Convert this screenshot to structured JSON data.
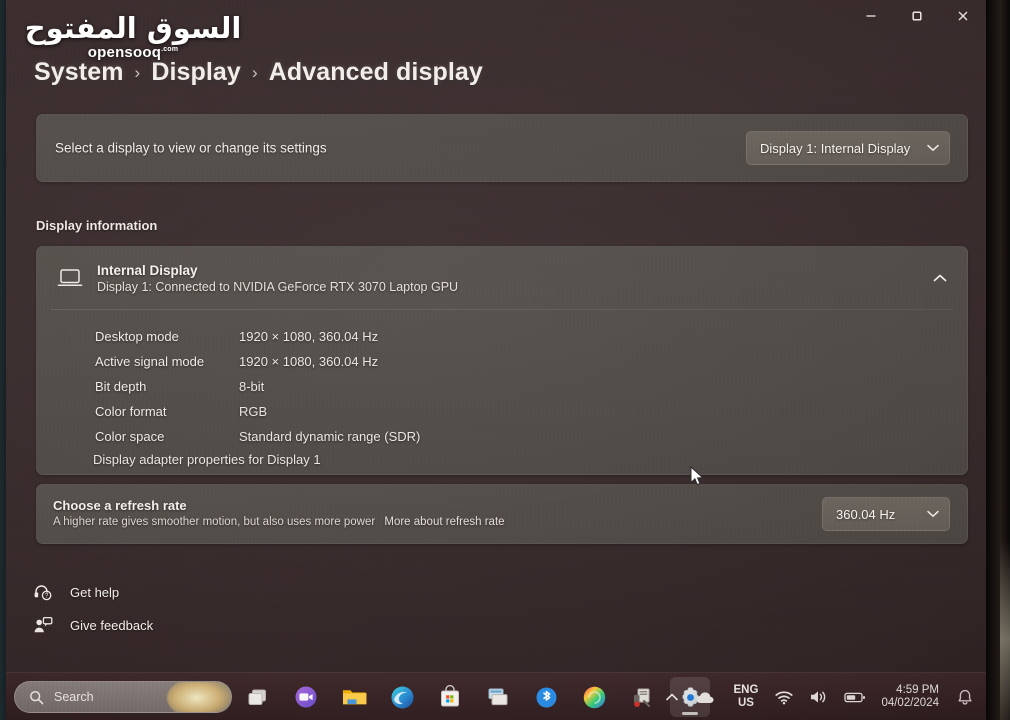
{
  "window": {
    "controls": {
      "minimize": "Minimize",
      "maximize": "Restore",
      "close": "Close"
    }
  },
  "watermark": {
    "arabic": "السوق المفتوح",
    "latin": "opensooq",
    "suffix": ".com"
  },
  "breadcrumb": {
    "items": [
      "System",
      "Display",
      "Advanced display"
    ],
    "separator": "›"
  },
  "select_display": {
    "label": "Select a display to view or change its settings",
    "combo_value": "Display 1: Internal Display",
    "chevron": "⌄"
  },
  "display_information": {
    "heading": "Display information",
    "device_title": "Internal Display",
    "device_subtitle": "Display 1: Connected to NVIDIA GeForce RTX 3070 Laptop GPU",
    "rows": [
      {
        "key": "Desktop mode",
        "value": "1920 × 1080, 360.04 Hz"
      },
      {
        "key": "Active signal mode",
        "value": "1920 × 1080, 360.04 Hz"
      },
      {
        "key": "Bit depth",
        "value": "8-bit"
      },
      {
        "key": "Color format",
        "value": "RGB"
      },
      {
        "key": "Color space",
        "value": "Standard dynamic range (SDR)"
      }
    ],
    "adapter_link": "Display adapter properties for Display 1"
  },
  "refresh_rate": {
    "title": "Choose a refresh rate",
    "description": "A higher rate gives smoother motion, but also uses more power",
    "more_link": "More about refresh rate",
    "combo_value": "360.04 Hz"
  },
  "footer": {
    "get_help": "Get help",
    "give_feedback": "Give feedback"
  },
  "taskbar": {
    "search_placeholder": "Search",
    "apps": [
      {
        "name": "task-view",
        "label": "Task view"
      },
      {
        "name": "chat",
        "label": "Chat"
      },
      {
        "name": "file-explorer",
        "label": "File Explorer"
      },
      {
        "name": "edge",
        "label": "Microsoft Edge"
      },
      {
        "name": "microsoft-store",
        "label": "Microsoft Store"
      },
      {
        "name": "app-window",
        "label": "App"
      },
      {
        "name": "bluetooth",
        "label": "Bluetooth"
      },
      {
        "name": "paint-swirl-app",
        "label": "Creative app"
      },
      {
        "name": "tools-app",
        "label": "Tools app"
      },
      {
        "name": "settings",
        "label": "Settings"
      }
    ],
    "tray": {
      "overflow": "Show hidden icons",
      "cloud": "OneDrive",
      "language_line1": "ENG",
      "language_line2": "US",
      "network": "Network",
      "volume": "Volume",
      "battery": "Battery",
      "time": "4:59 PM",
      "date": "04/02/2024",
      "notifications": "Notifications"
    }
  },
  "colors": {
    "window_bg": "#3a2c2d",
    "card_bg": "#514b47",
    "combo_bg": "#665f59",
    "text_primary": "#f4efeb",
    "taskbar_bg": "#3a2527"
  }
}
